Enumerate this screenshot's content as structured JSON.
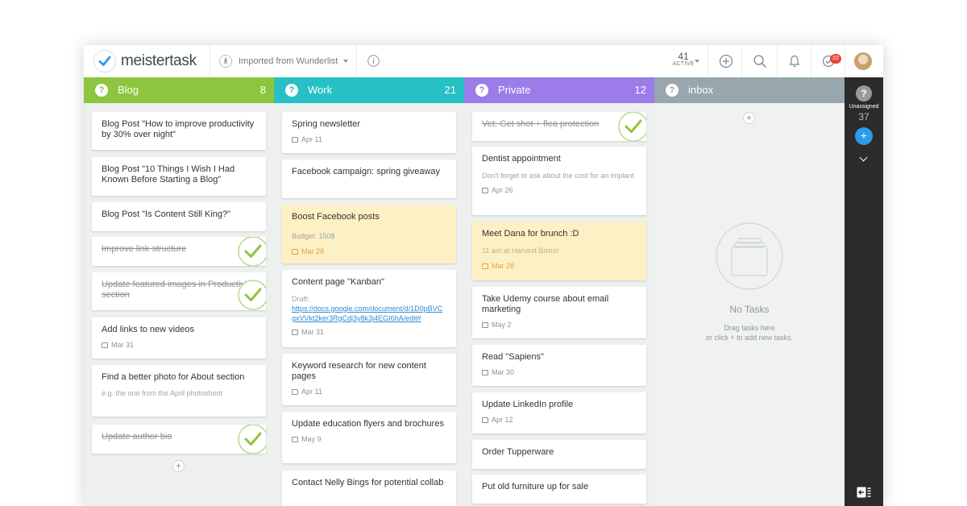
{
  "header": {
    "brand": "meistertask",
    "project": "Imported from Wunderlist",
    "active_count": "41",
    "active_label": "ACTIVE",
    "notification_badge": "22"
  },
  "icons": {
    "logo": "checkmark-icon",
    "project": "rocket-icon",
    "info": "info-icon",
    "add": "plus-circle-icon",
    "search": "search-icon",
    "notifications": "bell-icon",
    "my_tasks": "checkmark-icon"
  },
  "colors": {
    "blog": "#8cc63e",
    "work": "#27c0c4",
    "private": "#9b7ce8",
    "inbox": "#98a6ad",
    "accent": "#2b9bea"
  },
  "columns": {
    "blog": {
      "name": "Blog",
      "count": "8",
      "cards": [
        {
          "title": "Blog Post \"How to improve productivity by 30% over night\""
        },
        {
          "title": "Blog Post \"10 Things I Wish I Had Known Before Starting a Blog\""
        },
        {
          "title": "Blog Post \"Is Content Still King?\""
        },
        {
          "title": "Improve link structure"
        },
        {
          "title": "Update featured images in Productivity section"
        },
        {
          "title": "Add links to new videos",
          "date": "Mar 31"
        },
        {
          "title": "Find a better photo for About section",
          "note": "e.g. the one from the April photoshoot"
        },
        {
          "title": "Update author bio"
        }
      ]
    },
    "work": {
      "name": "Work",
      "count": "21",
      "cards": [
        {
          "title": "Spring newsletter",
          "date": "Apr 11"
        },
        {
          "title": "Facebook campaign: spring giveaway"
        },
        {
          "title": "Boost Facebook posts",
          "note": "Budget: 150$",
          "date": "Mar 28"
        },
        {
          "title": "Content page \"Kanban\"",
          "note": "Draft:",
          "link": "https://docs.google.com/document/d/1D0pBVCgxVVkt2ker3RgCdj3y8k3j4EGI6hA/edit#",
          "date": "Mar 31"
        },
        {
          "title": "Keyword research for new content pages",
          "date": "Apr 11"
        },
        {
          "title": "Update education flyers and brochures",
          "date": "May 9"
        },
        {
          "title": "Contact Nelly Bings for potential collab"
        }
      ]
    },
    "private": {
      "name": "Private",
      "count": "12",
      "cards": [
        {
          "title": "Vet: Get shot + flea protection"
        },
        {
          "title": "Dentist appointment",
          "note": "Don't forget to ask about the cost for an implant",
          "date": "Apr 26"
        },
        {
          "title": "Meet Dana for brunch :D",
          "note": "11 am at Harvest Bistro!",
          "date": "Mar 28"
        },
        {
          "title": "Take Udemy course about email marketing",
          "date": "May 2"
        },
        {
          "title": "Read \"Sapiens\"",
          "date": "Mar 30"
        },
        {
          "title": "Update LinkedIn profile",
          "date": "Apr 12"
        },
        {
          "title": "Order Tupperware"
        },
        {
          "title": "Put old furniture up for sale"
        }
      ]
    },
    "inbox": {
      "name": "inbox",
      "empty_title": "No Tasks",
      "empty_line1": "Drag tasks here",
      "empty_line2": "or click + to add new tasks."
    }
  },
  "rail": {
    "unassigned_label": "Unassigned",
    "unassigned_count": "37"
  }
}
